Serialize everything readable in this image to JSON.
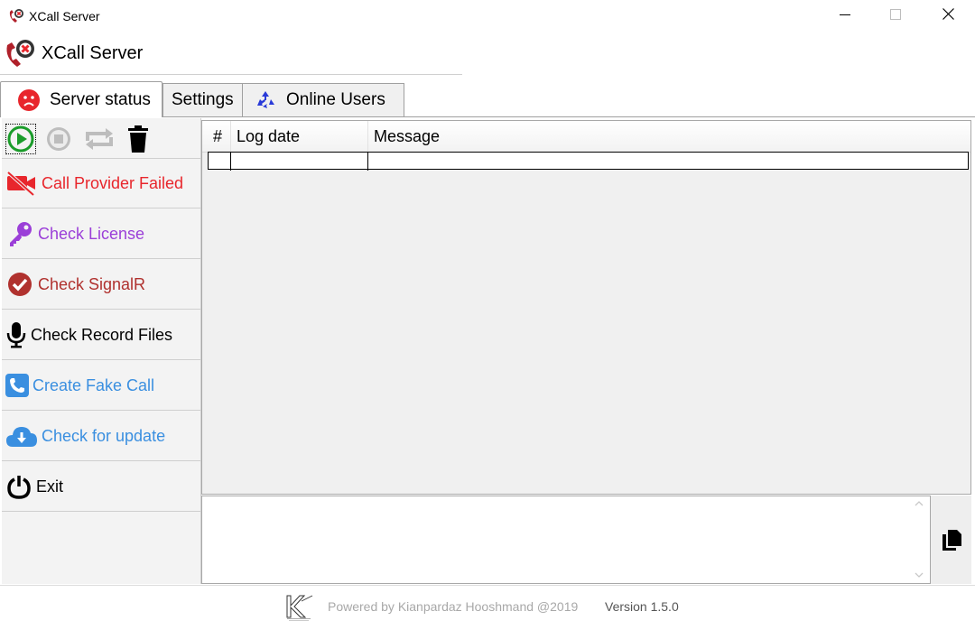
{
  "window": {
    "title": "XCall Server",
    "minimize_icon": "minimize-icon",
    "maximize_icon": "maximize-icon",
    "close_icon": "close-icon"
  },
  "header": {
    "title": "XCall Server",
    "logo_icon": "xcall-logo-icon"
  },
  "tabs": [
    {
      "label": "Server status",
      "icon": "sad-face-icon",
      "active": true
    },
    {
      "label": "Settings",
      "icon": "",
      "active": false
    },
    {
      "label": "Online Users",
      "icon": "recycle-icon",
      "active": false
    }
  ],
  "toolbar": {
    "play_icon": "play-icon",
    "stop_icon": "stop-icon",
    "repeat_icon": "repeat-icon",
    "trash_icon": "trash-icon"
  },
  "sidebar": {
    "items": [
      {
        "label": "Call Provider Failed",
        "icon": "video-off-icon",
        "color": "#e8262c"
      },
      {
        "label": "Check License",
        "icon": "key-icon",
        "color": "#9b3fd8"
      },
      {
        "label": "Check SignalR",
        "icon": "check-circle-icon",
        "color": "#b0312e"
      },
      {
        "label": "Check Record Files",
        "icon": "microphone-icon",
        "color": "#000000"
      },
      {
        "label": "Create Fake Call",
        "icon": "phone-icon",
        "color": "#3a8fe0"
      },
      {
        "label": "Check for update",
        "icon": "cloud-download-icon",
        "color": "#3a8fe0"
      },
      {
        "label": "Exit",
        "icon": "power-icon",
        "color": "#000000"
      }
    ]
  },
  "grid": {
    "columns": [
      "#",
      "Log date",
      "Message"
    ]
  },
  "copy_icon": "copy-icon",
  "footer": {
    "powered": "Powered by Kianpardaz Hooshmand @2019",
    "version": "Version 1.5.0"
  },
  "colors": {
    "accent_red": "#e8262c",
    "accent_blue": "#3a8fe0",
    "accent_purple": "#9b3fd8",
    "play_green": "#1a9c2a"
  }
}
